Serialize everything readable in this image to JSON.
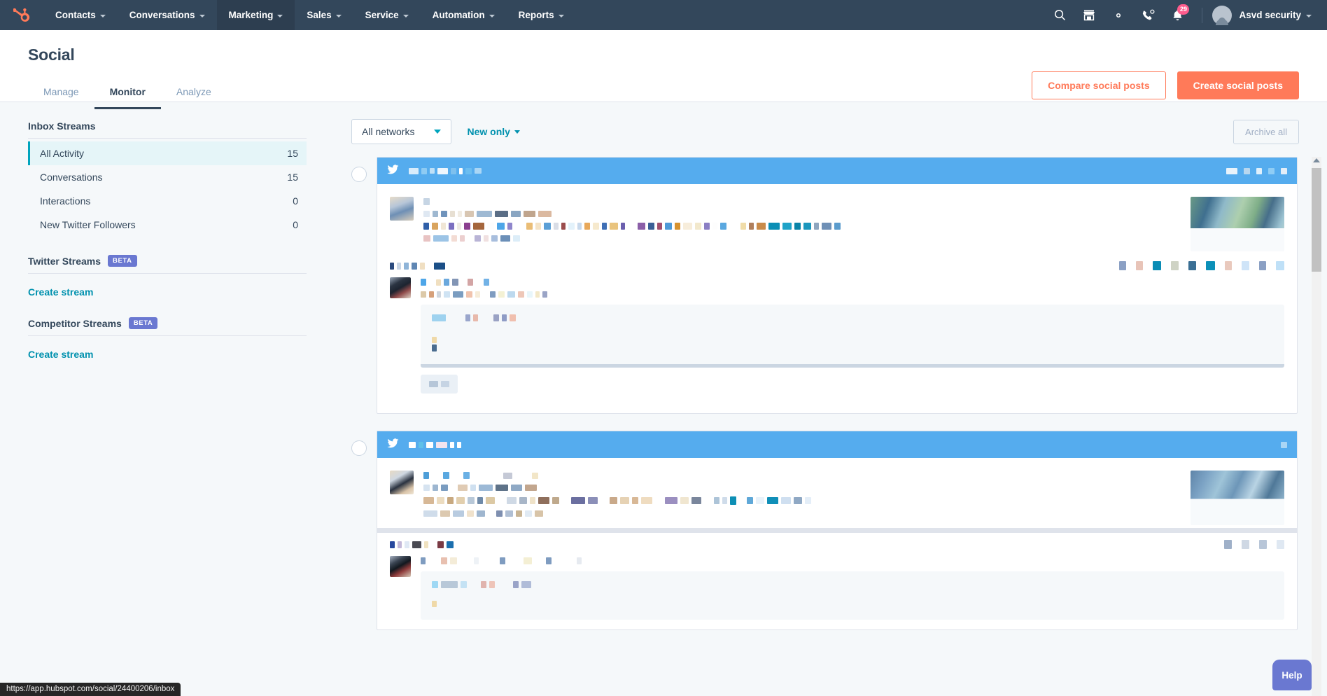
{
  "browser": {
    "status_url": "https://app.hubspot.com/social/24400206/inbox"
  },
  "topnav": {
    "logo_icon": "hubspot-sprocket-logo",
    "items": [
      {
        "label": "Contacts",
        "has_caret": true,
        "active": false
      },
      {
        "label": "Conversations",
        "has_caret": true,
        "active": false
      },
      {
        "label": "Marketing",
        "has_caret": true,
        "active": true
      },
      {
        "label": "Sales",
        "has_caret": true,
        "active": false
      },
      {
        "label": "Service",
        "has_caret": true,
        "active": false
      },
      {
        "label": "Automation",
        "has_caret": true,
        "active": false
      },
      {
        "label": "Reports",
        "has_caret": true,
        "active": false
      }
    ],
    "icons": [
      {
        "name": "search-icon"
      },
      {
        "name": "marketplace-icon"
      },
      {
        "name": "settings-gear-icon"
      },
      {
        "name": "calling-icon"
      },
      {
        "name": "notifications-bell-icon",
        "badge": "29"
      }
    ],
    "account": {
      "name": "Asvd security",
      "avatar_icon": "user-avatar"
    }
  },
  "page": {
    "title": "Social",
    "buttons": {
      "compare": "Compare social posts",
      "create": "Create social posts"
    },
    "tabs": [
      {
        "label": "Manage",
        "active": false
      },
      {
        "label": "Monitor",
        "active": true
      },
      {
        "label": "Analyze",
        "active": false
      }
    ]
  },
  "sidebar": {
    "inbox": {
      "heading": "Inbox Streams",
      "items": [
        {
          "label": "All Activity",
          "count": "15",
          "active": true
        },
        {
          "label": "Conversations",
          "count": "15",
          "active": false
        },
        {
          "label": "Interactions",
          "count": "0",
          "active": false
        },
        {
          "label": "New Twitter Followers",
          "count": "0",
          "active": false
        }
      ]
    },
    "twitter": {
      "heading": "Twitter Streams",
      "badge": "BETA",
      "create_link": "Create stream"
    },
    "competitor": {
      "heading": "Competitor Streams",
      "badge": "BETA",
      "create_link": "Create stream"
    }
  },
  "toolbar": {
    "network_filter": "All networks",
    "new_only_filter": "New only",
    "archive_all": "Archive all"
  },
  "feed": {
    "scrollbar": {
      "up_arrow_icon": "scroll-up-arrow"
    },
    "posts": [
      {
        "network_icon": "twitter-bird-icon",
        "header_redacted": true,
        "has_thumbnail": true,
        "thumbnail_tone": "green-blue-landscape",
        "has_reply": true,
        "has_quote_block": true,
        "has_tag_pill": true
      },
      {
        "network_icon": "twitter-bird-icon",
        "header_redacted": true,
        "has_thumbnail": true,
        "thumbnail_tone": "blue-teal-landscape",
        "has_reply": true,
        "has_quote_block": true,
        "has_tag_pill": false
      }
    ]
  },
  "help": {
    "label": "Help"
  },
  "colors": {
    "nav_bg": "#33475b",
    "accent_orange": "#ff7a59",
    "accent_teal": "#0091ae",
    "card_header_blue": "#55acee",
    "beta_purple": "#6a78d1",
    "page_bg": "#f5f8fa",
    "badge_pink": "#ff5c8d"
  }
}
